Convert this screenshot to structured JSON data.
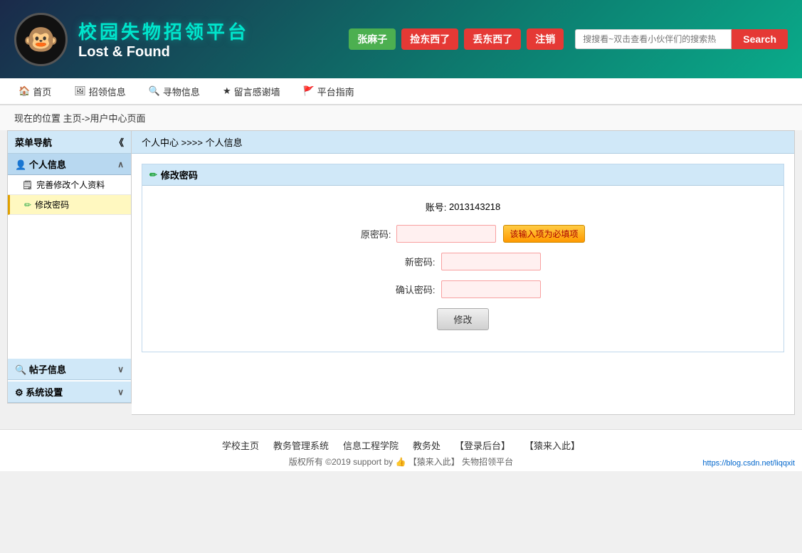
{
  "header": {
    "title_cn": "校园失物招领平台",
    "title_en": "Lost & Found",
    "logo_emoji": "🐵",
    "user_name": "张麻子",
    "btn_found": "捡东西了",
    "btn_lost": "丢东西了",
    "btn_logout": "注销",
    "search_placeholder": "搜搜看~双击查看小伙伴们的搜索热",
    "search_btn": "Search"
  },
  "navbar": {
    "items": [
      {
        "label": "首页",
        "icon": "🏠"
      },
      {
        "label": "招领信息",
        "icon": "🖼"
      },
      {
        "label": "寻物信息",
        "icon": "🔍"
      },
      {
        "label": "留言感谢墙",
        "icon": "★"
      },
      {
        "label": "平台指南",
        "icon": "🚩"
      }
    ]
  },
  "breadcrumb": {
    "text": "现在的位置 主页->用户中心页面"
  },
  "sidebar": {
    "header_label": "菜单导航",
    "header_icon": "《",
    "sections": [
      {
        "label": "个人信息",
        "icon": "👤",
        "chevron": "∧",
        "items": [
          {
            "label": "完善修改个人资料",
            "active": false
          },
          {
            "label": "修改密码",
            "active": true
          }
        ]
      }
    ],
    "bottom_sections": [
      {
        "label": "帖子信息",
        "icon": "🔍",
        "chevron": "∨"
      },
      {
        "label": "系统设置",
        "icon": "⚙",
        "chevron": "∨"
      }
    ]
  },
  "content": {
    "breadcrumb": "个人中心 >>>> 个人信息",
    "form_title": "修改密码",
    "account_label": "账号:",
    "account_value": "2013143218",
    "old_pwd_label": "原密码:",
    "new_pwd_label": "新密码:",
    "confirm_pwd_label": "确认密码:",
    "required_badge": "该输入项为必填项",
    "submit_btn": "修改"
  },
  "footer": {
    "links": [
      {
        "label": "学校主页"
      },
      {
        "label": "教务管理系统"
      },
      {
        "label": "信息工程学院"
      },
      {
        "label": "教务处"
      },
      {
        "label": "【登录后台】"
      },
      {
        "label": "【猿来入此】"
      }
    ],
    "copyright": "版权所有 ©2019 support by 👍 【猿来入此】 失物招领平台",
    "url": "https://blog.csdn.net/liqqxit"
  }
}
